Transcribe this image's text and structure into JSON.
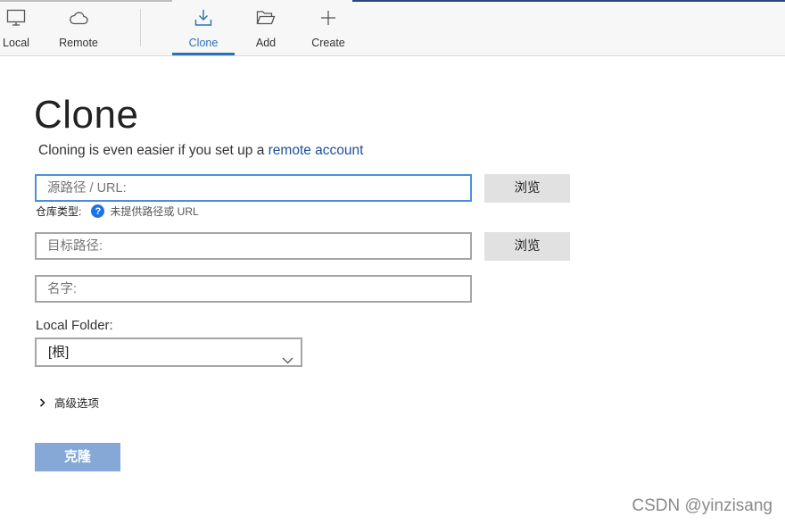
{
  "toolbar": {
    "buttons": [
      {
        "label": "Local",
        "icon": "monitor-icon"
      },
      {
        "label": "Remote",
        "icon": "cloud-icon"
      },
      {
        "label": "Clone",
        "icon": "download-icon",
        "active": true
      },
      {
        "label": "Add",
        "icon": "folder-open-icon"
      },
      {
        "label": "Create",
        "icon": "plus-icon"
      }
    ]
  },
  "main": {
    "title": "Clone",
    "subtitle_text": "Cloning is even easier if you set up a ",
    "subtitle_link": "remote account",
    "source": {
      "placeholder": "源路径 / URL:",
      "value": "",
      "browse_label": "浏览"
    },
    "repo_type": {
      "label": "仓库类型:",
      "status": "未提供路径或 URL"
    },
    "destination": {
      "placeholder": "目标路径:",
      "value": "",
      "browse_label": "浏览"
    },
    "name": {
      "placeholder": "名字:",
      "value": ""
    },
    "local_folder": {
      "label": "Local Folder:",
      "selected": "[根]"
    },
    "advanced_label": "高级选项",
    "clone_button": "克隆"
  },
  "watermark": "CSDN @yinzisang",
  "colors": {
    "accent": "#2f6fb8",
    "link": "#1e4e9a",
    "clone_button_bg": "#86a8d6",
    "help_icon": "#1a73e8",
    "focus_border": "#4a90d9"
  }
}
